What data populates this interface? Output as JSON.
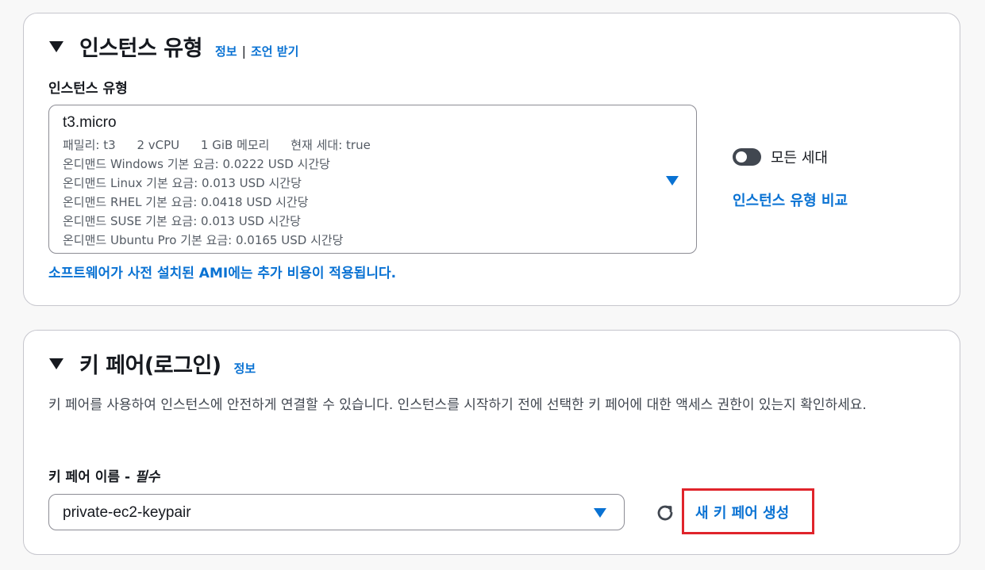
{
  "instance_type_panel": {
    "title": "인스턴스 유형",
    "info_link": "정보",
    "separator": "|",
    "advice_link": "조언 받기",
    "field_label": "인스턴스 유형",
    "selected": {
      "name": "t3.micro",
      "specs": [
        "패밀리: t3",
        "2 vCPU",
        "1 GiB 메모리",
        "현재 세대: true"
      ],
      "pricing": [
        "온디맨드 Windows 기본 요금: 0.0222 USD 시간당",
        "온디맨드 Linux 기본 요금: 0.013 USD 시간당",
        "온디맨드 RHEL 기본 요금: 0.0418 USD 시간당",
        "온디맨드 SUSE 기본 요금: 0.013 USD 시간당",
        "온디맨드 Ubuntu Pro 기본 요금: 0.0165 USD 시간당"
      ]
    },
    "ami_note": "소프트웨어가 사전 설치된 AMI에는 추가 비용이 적용됩니다.",
    "toggle_label": "모든 세대",
    "toggle_on": false,
    "compare_link": "인스턴스 유형 비교"
  },
  "keypair_panel": {
    "title": "키 페어(로그인)",
    "info_link": "정보",
    "description": "키 페어를 사용하여 인스턴스에 안전하게 연결할 수 있습니다. 인스턴스를 시작하기 전에 선택한 키 페어에 대한 액세스 권한이 있는지 확인하세요.",
    "field_label": "키 페어 이름 - ",
    "field_required": "필수",
    "selected_keypair": "private-ec2-keypair",
    "create_link": "새 키 페어 생성"
  },
  "colors": {
    "link": "#0972d3",
    "highlight_border": "#e0242b",
    "toggle_off": "#414750"
  }
}
